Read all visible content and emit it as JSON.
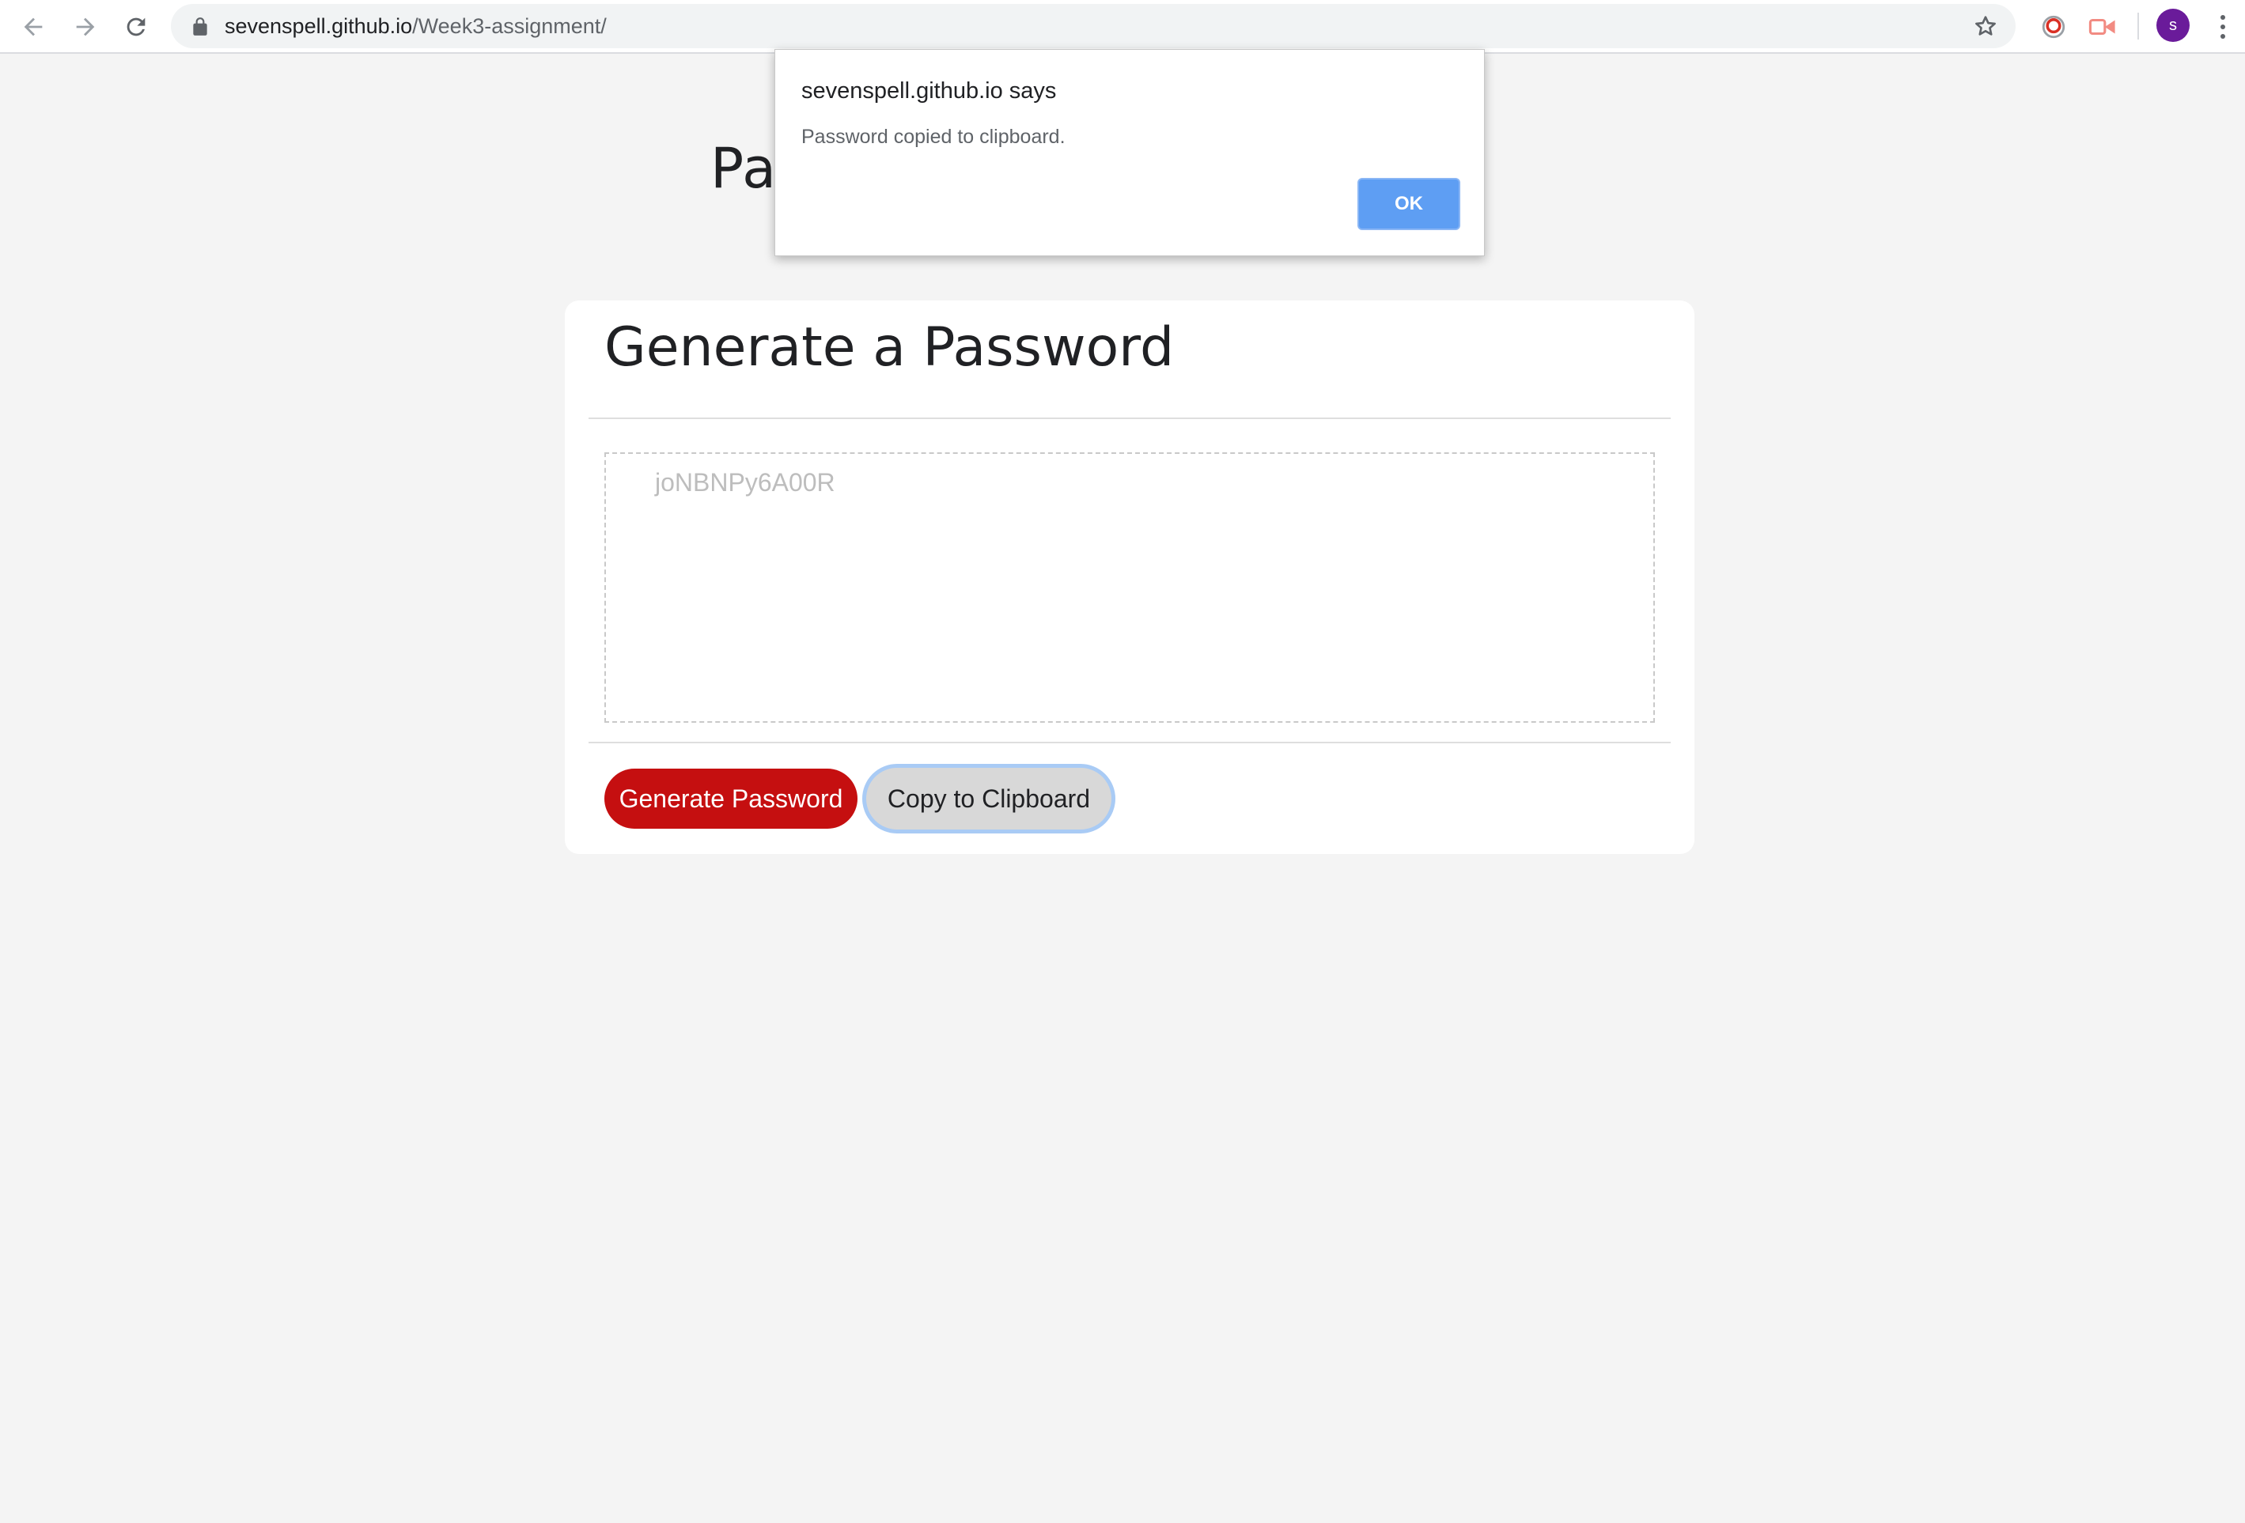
{
  "browser": {
    "url_host": "sevenspell.github.io",
    "url_path": "/Week3-assignment/",
    "profile_initial": "s",
    "icons": {
      "back": "arrow-left-icon",
      "forward": "arrow-right-icon",
      "reload": "reload-icon",
      "lock": "lock-icon",
      "bookmark": "star-icon",
      "ext1": "extension-ring-icon",
      "ext2": "extension-video-icon",
      "menu": "more-vert-icon"
    },
    "colors": {
      "avatar": "#6a1b9a"
    }
  },
  "page": {
    "heading_visible": "Pas",
    "card": {
      "title": "Generate a Password",
      "password_value": "joNBNPy6A00R",
      "generate_label": "Generate Password",
      "copy_label": "Copy to Clipboard"
    },
    "colors": {
      "generate_button": "#c50f10",
      "copy_button": "#d8d8d8"
    }
  },
  "dialog": {
    "title": "sevenspell.github.io says",
    "message": "Password copied to clipboard.",
    "ok_label": "OK",
    "colors": {
      "ok_button": "#5e9ef3"
    }
  }
}
